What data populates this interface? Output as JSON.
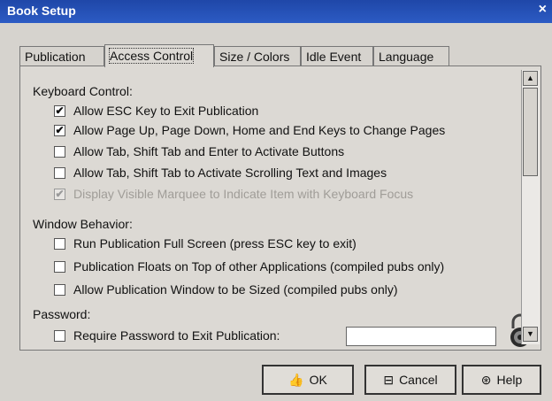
{
  "window": {
    "title": "Book Setup",
    "close_glyph": "×"
  },
  "tabs": [
    {
      "label": "Publication",
      "active": false
    },
    {
      "label": "Access Control",
      "active": true
    },
    {
      "label": "Size / Colors",
      "active": false
    },
    {
      "label": "Idle Event",
      "active": false
    },
    {
      "label": "Language",
      "active": false
    }
  ],
  "keyboard": {
    "heading": "Keyboard Control:",
    "items": [
      {
        "label": "Allow ESC Key to Exit Publication",
        "checked": true,
        "enabled": true
      },
      {
        "label": "Allow Page Up, Page Down, Home and End Keys to Change Pages",
        "checked": true,
        "enabled": true
      },
      {
        "label": "Allow Tab, Shift Tab and Enter to Activate Buttons",
        "checked": false,
        "enabled": true
      },
      {
        "label": "Allow Tab, Shift Tab to Activate Scrolling Text and Images",
        "checked": false,
        "enabled": true
      },
      {
        "label": "Display Visible Marquee to Indicate Item with Keyboard Focus",
        "checked": true,
        "enabled": false
      }
    ]
  },
  "window_behavior": {
    "heading": "Window Behavior:",
    "items": [
      {
        "label": "Run Publication Full Screen (press ESC key to exit)",
        "checked": false
      },
      {
        "label": "Publication Floats on Top of other Applications (compiled pubs only)",
        "checked": false
      },
      {
        "label": "Allow Publication Window to be Sized (compiled pubs only)",
        "checked": false
      }
    ]
  },
  "password": {
    "heading": "Password:",
    "label": "Require Password to Exit Publication:",
    "checked": false,
    "value": "",
    "lock_icon": "padlock-icon"
  },
  "buttons": {
    "ok": "OK",
    "cancel": "Cancel",
    "help": "Help",
    "ok_icon": "thumbs-up-icon",
    "cancel_icon": "cancel-icon",
    "help_icon": "help-life-ring-icon"
  },
  "colors": {
    "titlebar": "#1f47a8",
    "dialog": "#d6d3ce"
  }
}
